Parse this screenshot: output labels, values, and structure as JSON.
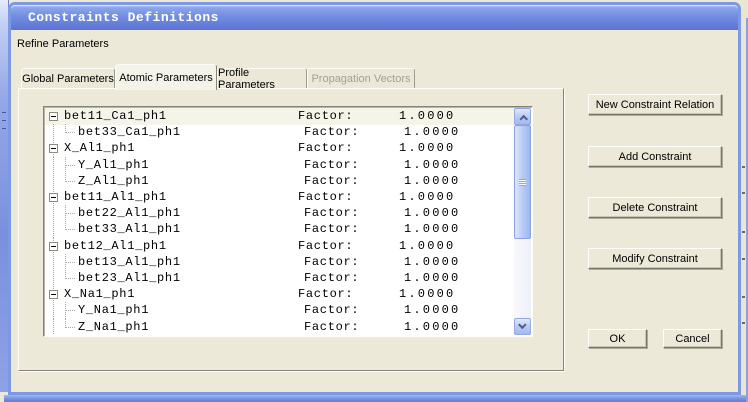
{
  "window": {
    "title": "Constraints Definitions"
  },
  "panel": {
    "refine_label": "Refine Parameters"
  },
  "tabs": [
    {
      "label": "Global Parameters",
      "state": "inactive"
    },
    {
      "label": "Atomic Parameters",
      "state": "active"
    },
    {
      "label": "Profile Parameters",
      "state": "inactive"
    },
    {
      "label": "Propagation Vectors",
      "state": "disabled"
    }
  ],
  "constraint_list": {
    "factor_label": "Factor:",
    "rows": [
      {
        "label": "bet11_Ca1_ph1",
        "level": 0,
        "value": "1.0000",
        "selected": true
      },
      {
        "label": "bet33_Ca1_ph1",
        "level": 1,
        "value": "1.0000"
      },
      {
        "label": "X_Al1_ph1",
        "level": 0,
        "value": "1.0000"
      },
      {
        "label": "Y_Al1_ph1",
        "level": 1,
        "value": "1.0000"
      },
      {
        "label": "Z_Al1_ph1",
        "level": 1,
        "value": "1.0000"
      },
      {
        "label": "bet11_Al1_ph1",
        "level": 0,
        "value": "1.0000"
      },
      {
        "label": "bet22_Al1_ph1",
        "level": 1,
        "value": "1.0000"
      },
      {
        "label": "bet33_Al1_ph1",
        "level": 1,
        "value": "1.0000"
      },
      {
        "label": "bet12_Al1_ph1",
        "level": 0,
        "value": "1.0000"
      },
      {
        "label": "bet13_Al1_ph1",
        "level": 1,
        "value": "1.0000"
      },
      {
        "label": "bet23_Al1_ph1",
        "level": 1,
        "value": "1.0000"
      },
      {
        "label": "X_Na1_ph1",
        "level": 0,
        "value": "1.0000"
      },
      {
        "label": "Y_Na1_ph1",
        "level": 1,
        "value": "1.0000"
      },
      {
        "label": "Z_Na1_ph1",
        "level": 1,
        "value": "1.0000"
      }
    ]
  },
  "side_buttons": [
    {
      "label": "New Constraint Relation"
    },
    {
      "label": "Add Constraint"
    },
    {
      "label": "Delete Constraint"
    },
    {
      "label": "Modify Constraint"
    }
  ],
  "footer_buttons": {
    "ok": "OK",
    "cancel": "Cancel"
  },
  "icons": {
    "collapse": "minus-box-icon",
    "scroll_up": "chevron-up-icon",
    "scroll_down": "chevron-down-icon"
  },
  "colors": {
    "titlebar_blue": "#7590e3",
    "window_border_blue": "#7e99e3",
    "dialog_bg": "#ece9d8",
    "list_bg": "#ffffff",
    "selected_row_bg": "#f5f4e8",
    "disabled_tab_text": "#a3a095",
    "scrollbar_blue": "#b6c9f6"
  }
}
